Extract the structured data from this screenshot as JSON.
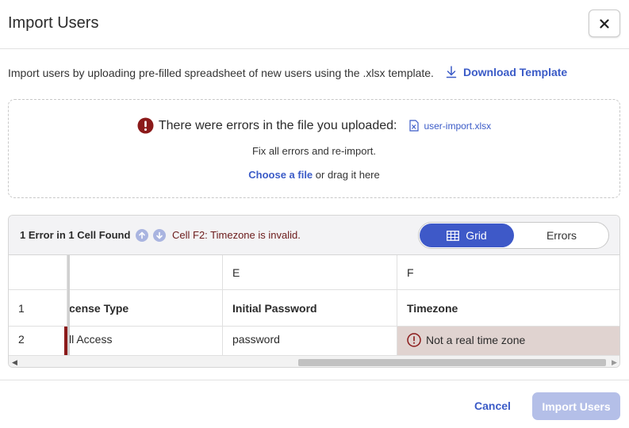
{
  "dialog": {
    "title": "Import Users",
    "close_label": "×",
    "intro_text": "Import users by uploading pre-filled spreadsheet of new users using the .xlsx template.",
    "download_label": "Download Template"
  },
  "dropzone": {
    "error_text": "There were errors in the file you uploaded:",
    "file_name": "user-import.xlsx",
    "fix_text": "Fix all errors and re-import.",
    "choose_label": "Choose a file",
    "drag_text": "or drag it here"
  },
  "grid_panel": {
    "error_count": "1 Error in 1 Cell Found",
    "cell_message": "Cell F2: Timezone is invalid.",
    "toggle": {
      "grid_label": "Grid",
      "errors_label": "Errors",
      "selected": "Grid"
    },
    "columns": [
      "",
      "",
      "E",
      "F"
    ],
    "rows": [
      {
        "num": "1",
        "d": "cense Type",
        "e": "Initial Password",
        "f": "Timezone"
      },
      {
        "num": "2",
        "d": "ll Access",
        "e": "password",
        "f": "Not a real time zone"
      }
    ]
  },
  "footer": {
    "cancel_label": "Cancel",
    "import_label": "Import Users"
  },
  "colors": {
    "accent": "#3e59c8",
    "error": "#8b1a1a",
    "error_cell_bg": "#e0d3d0",
    "disabled_button": "#b4bfe8"
  }
}
